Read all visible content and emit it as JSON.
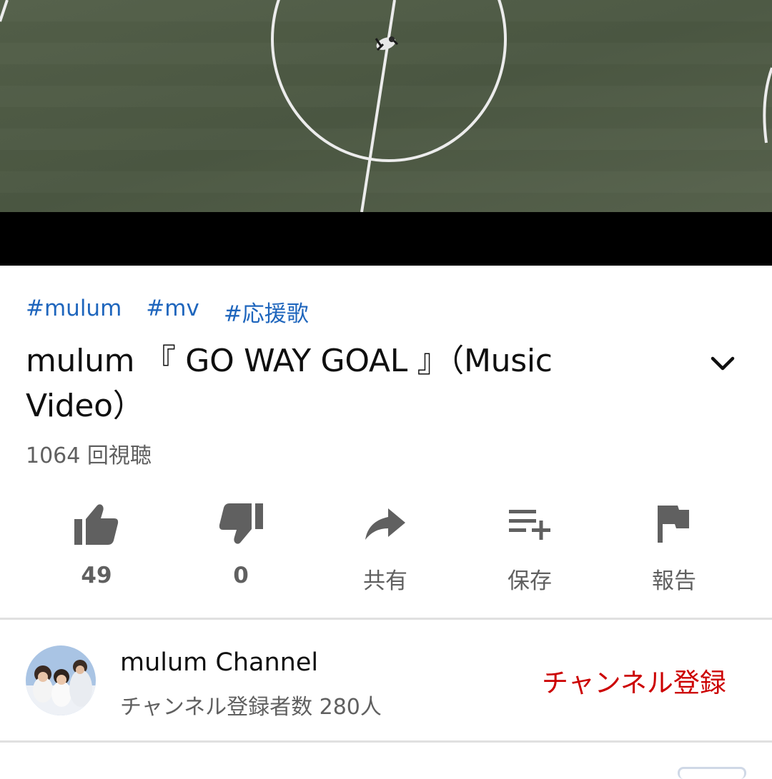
{
  "video": {
    "grass_color": "#4e5a44",
    "line_color": "#f2f2f2"
  },
  "hashtags": [
    "#mulum",
    "#mv",
    "#応援歌"
  ],
  "title_line1": "mulum 『 GO WAY GOAL 』（Music",
  "title_line2": "Video）",
  "views": "1064 回視聴",
  "actions": {
    "like": {
      "label": "49",
      "icon": "thumbs-up-icon"
    },
    "dislike": {
      "label": "0",
      "icon": "thumbs-down-icon"
    },
    "share": {
      "label": "共有",
      "icon": "share-icon"
    },
    "save": {
      "label": "保存",
      "icon": "playlist-add-icon"
    },
    "report": {
      "label": "報告",
      "icon": "flag-icon"
    }
  },
  "channel": {
    "name": "mulum Channel",
    "subscribers": "チャンネル登録者数 280人",
    "subscribe_label": "チャンネル登録"
  },
  "colors": {
    "hashtag": "#1f66bd",
    "subscribe": "#cc0000",
    "icon": "#606060"
  }
}
